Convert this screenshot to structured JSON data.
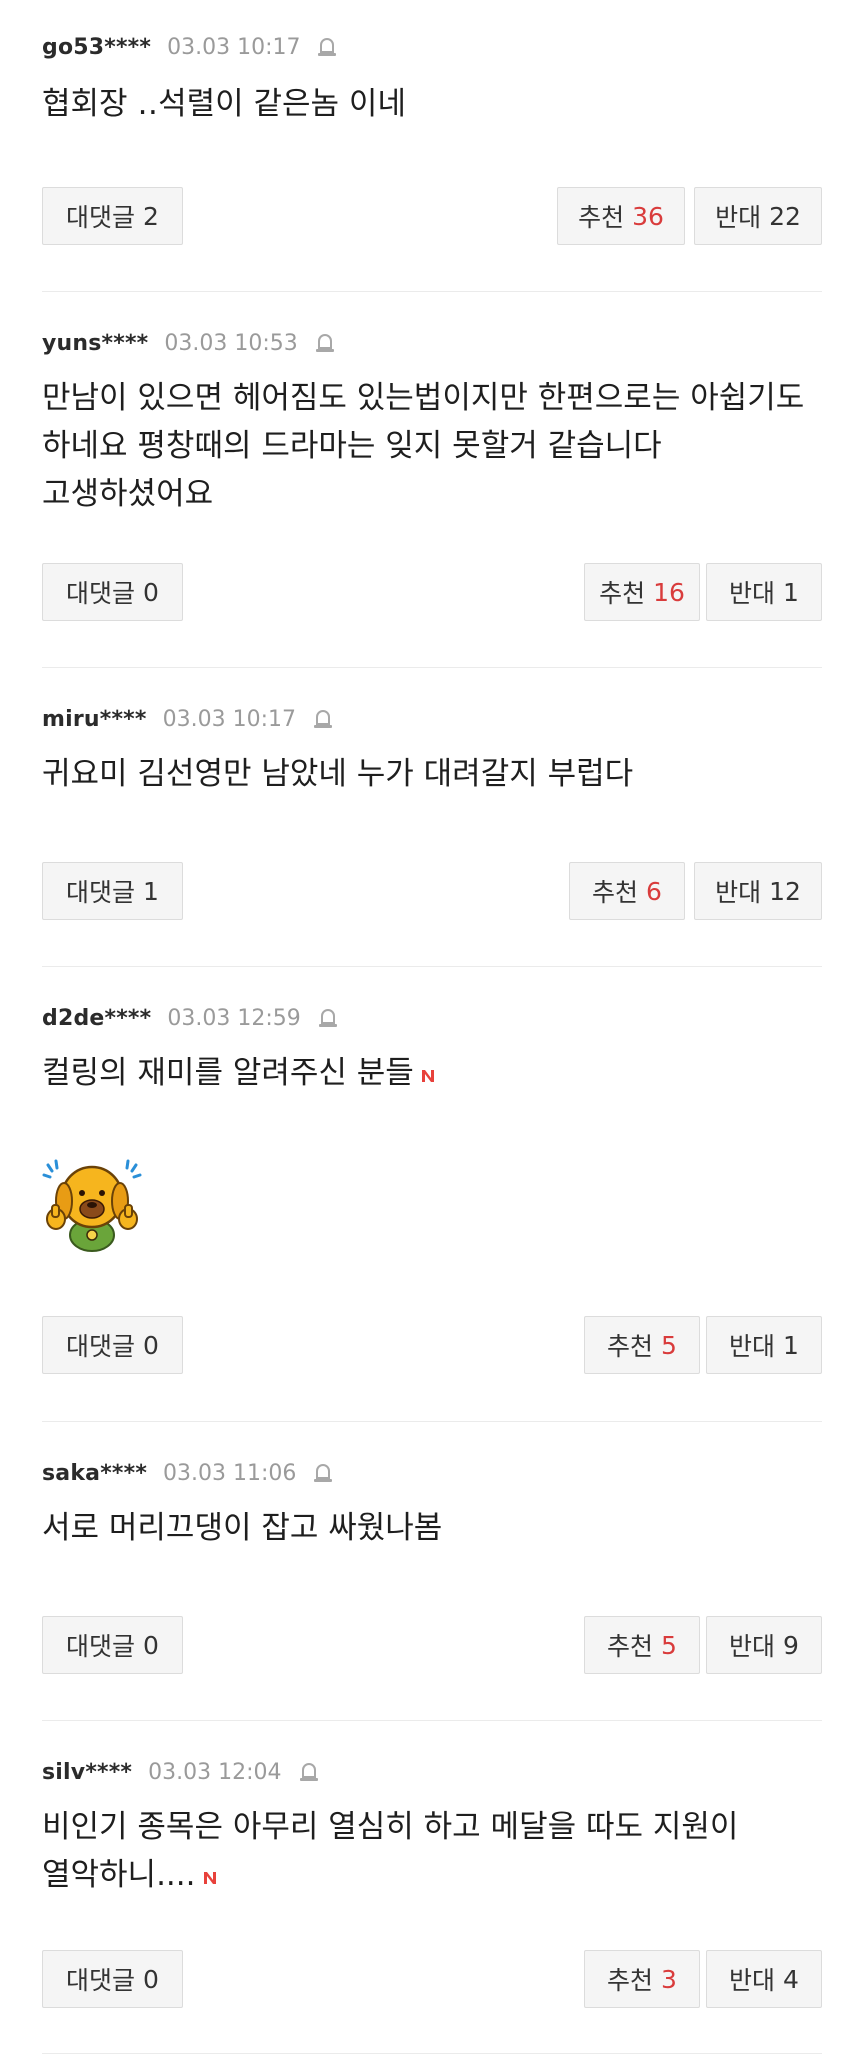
{
  "comments": [
    {
      "username": "go53****",
      "timestamp": "03.03 10:17",
      "body": "협회장 ‥석렬이 같은놈 이네",
      "has_new_badge": false,
      "has_sticker": false,
      "reply_label": "대댓글",
      "reply_count": "2",
      "like_label": "추천",
      "like_count": "36",
      "dislike_label": "반대",
      "dislike_count": "22"
    },
    {
      "username": "yuns****",
      "timestamp": "03.03 10:53",
      "body": "만남이 있으면 헤어짐도 있는법이지만 한편으로는 아쉽기도 하네요 평창때의 드라마는 잊지 못할거 같습니다 고생하셨어요",
      "has_new_badge": false,
      "has_sticker": false,
      "reply_label": "대댓글",
      "reply_count": "0",
      "like_label": "추천",
      "like_count": "16",
      "dislike_label": "반대",
      "dislike_count": "1"
    },
    {
      "username": "miru****",
      "timestamp": "03.03 10:17",
      "body": "귀요미 김선영만 남았네 누가 대려갈지 부럽다",
      "has_new_badge": false,
      "has_sticker": false,
      "reply_label": "대댓글",
      "reply_count": "1",
      "like_label": "추천",
      "like_count": "6",
      "dislike_label": "반대",
      "dislike_count": "12"
    },
    {
      "username": "d2de****",
      "timestamp": "03.03 12:59",
      "body": "컬링의 재미를 알려주신 분들",
      "has_new_badge": true,
      "has_sticker": true,
      "reply_label": "대댓글",
      "reply_count": "0",
      "like_label": "추천",
      "like_count": "5",
      "dislike_label": "반대",
      "dislike_count": "1"
    },
    {
      "username": "saka****",
      "timestamp": "03.03 11:06",
      "body": "서로 머리끄댕이 잡고 싸웠나봄",
      "has_new_badge": false,
      "has_sticker": false,
      "reply_label": "대댓글",
      "reply_count": "0",
      "like_label": "추천",
      "like_count": "5",
      "dislike_label": "반대",
      "dislike_count": "9"
    },
    {
      "username": "silv****",
      "timestamp": "03.03 12:04",
      "body": "비인기 종목은 아무리 열심히 하고 메달을 따도 지원이 열악하니....",
      "has_new_badge": true,
      "has_sticker": false,
      "reply_label": "대댓글",
      "reply_count": "0",
      "like_label": "추천",
      "like_count": "3",
      "dislike_label": "반대",
      "dislike_count": "4"
    }
  ],
  "colors": {
    "like_count": "#d93c3c",
    "new_badge": "#e8413b",
    "timestamp": "#9a9a9a",
    "button_bg": "#f5f5f5",
    "divider": "#ebebeb"
  },
  "icons": {
    "report": "siren-icon",
    "new": "new-badge-icon",
    "sticker": "thumbs-up-dog-sticker"
  }
}
